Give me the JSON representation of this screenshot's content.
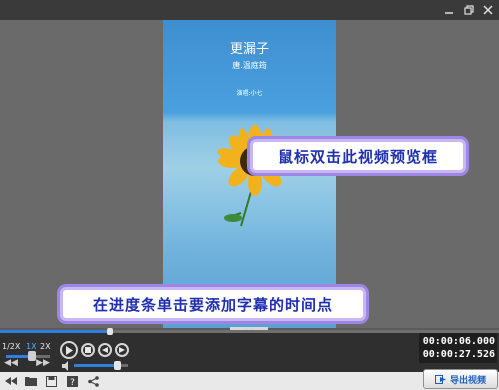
{
  "window": {
    "minimize_icon": "minimize-icon",
    "restore_icon": "restore-icon",
    "close_icon": "close-icon"
  },
  "preview": {
    "title": "更漏子",
    "author": "唐.温庭筠",
    "singer": "演唱:小七",
    "callout_preview": "鼠标双击此视频预览框",
    "callout_progress": "在进度条单击要添加字幕的时间点"
  },
  "playback": {
    "speed_options": [
      "1/2X",
      "1X",
      "2X"
    ],
    "selected_speed": "1X",
    "progress_fraction": 0.22,
    "speed_fraction": 0.6,
    "volume_fraction": 0.8,
    "current_time": "00:00:06.000",
    "total_time": "00:00:27.526"
  },
  "toolbar": {
    "icons": [
      "rewind-icon",
      "folder-icon",
      "save-icon",
      "help-icon",
      "share-icon"
    ],
    "export_label": "导出视频"
  },
  "colors": {
    "accent": "#2d7fe0",
    "callout_text": "#1f2fb0",
    "callout_border": "#9d86e6"
  }
}
